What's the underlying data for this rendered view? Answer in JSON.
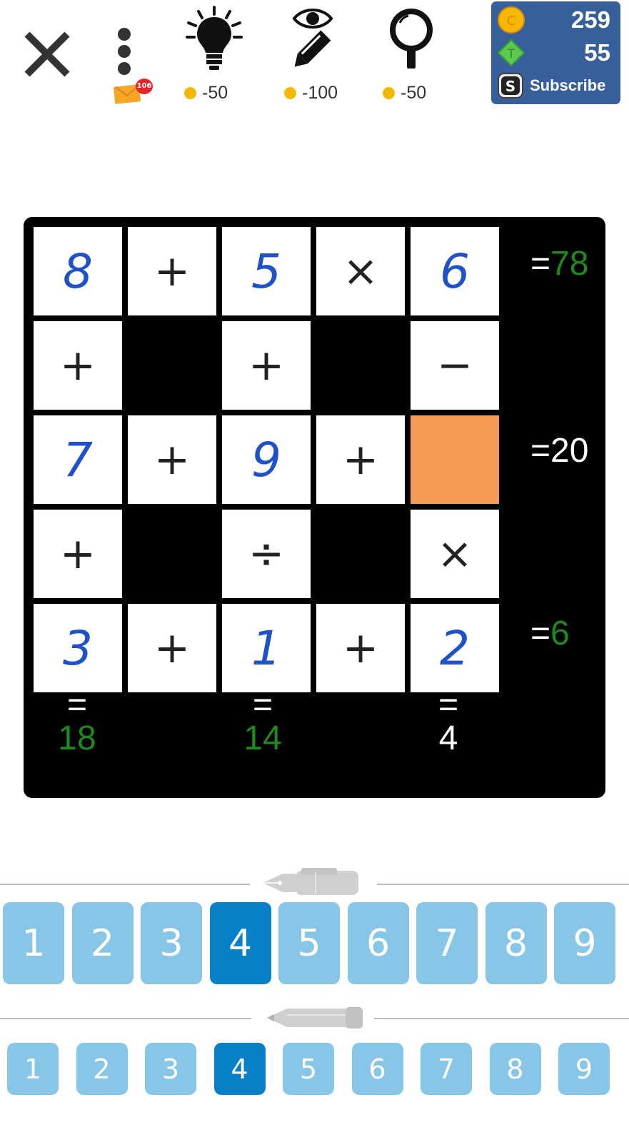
{
  "toolbar": {
    "mail_badge": "106",
    "hint_cost": "-50",
    "reveal_cost": "-100",
    "check_cost": "-50"
  },
  "wallet": {
    "coins": "259",
    "tickets": "55",
    "subscribe_label": "Subscribe"
  },
  "board": {
    "rows": [
      [
        "8",
        "+",
        "5",
        "×",
        "6"
      ],
      [
        "+",
        "",
        "+",
        "",
        "−"
      ],
      [
        "7",
        "+",
        "9",
        "+",
        ""
      ],
      [
        "+",
        "",
        "÷",
        "",
        "×"
      ],
      [
        "3",
        "+",
        "1",
        "+",
        "2"
      ]
    ],
    "row_results": [
      "=",
      "78",
      "=",
      "20",
      "=",
      "6"
    ],
    "r1": "78",
    "r2": "20",
    "r3": "6",
    "eq": "=",
    "c1": "18",
    "c2": "14",
    "c3": "4"
  },
  "keypad": {
    "pen_keys": [
      "1",
      "2",
      "3",
      "4",
      "5",
      "6",
      "7",
      "8",
      "9"
    ],
    "pencil_keys": [
      "1",
      "2",
      "3",
      "4",
      "5",
      "6",
      "7",
      "8",
      "9"
    ],
    "selected": "4"
  },
  "colors": {
    "solved_result": "#1e8a1e",
    "unsolved_result": "#ffffff",
    "selected_cell": "#f59a53",
    "digit_blue": "#1f52c8",
    "key_bg": "#87c6e7",
    "key_active": "#0880c8",
    "wallet_bg": "#375f9b"
  }
}
